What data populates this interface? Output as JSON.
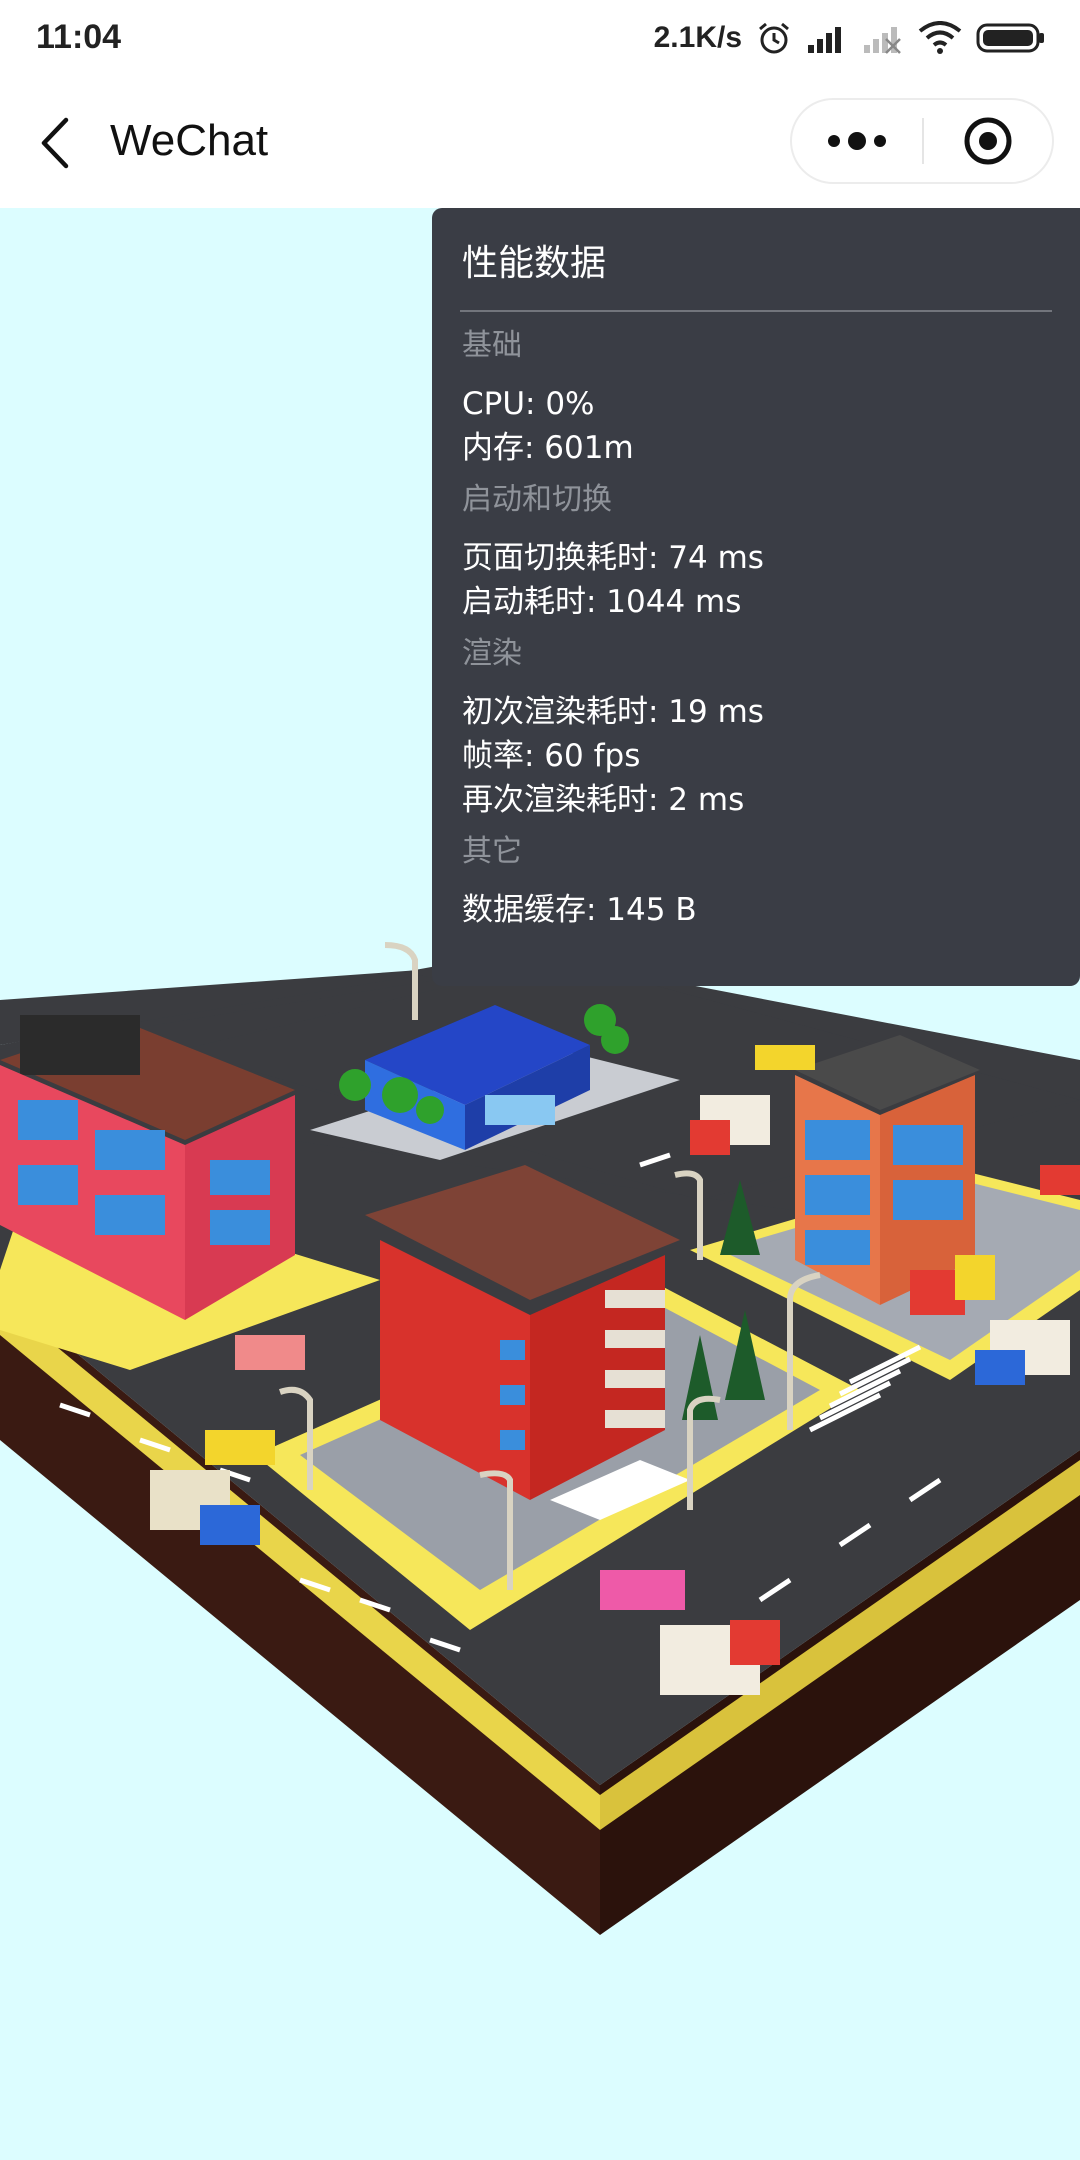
{
  "status_bar": {
    "time": "11:04",
    "net_speed": "2.1K/s",
    "icons": [
      "alarm-icon",
      "signal-icon",
      "signal-nosim-icon",
      "wifi-icon",
      "battery-icon"
    ]
  },
  "nav": {
    "title": "WeChat",
    "back_icon": "chevron-left-icon",
    "more_icon": "more-dots-icon",
    "close_icon": "target-circle-icon"
  },
  "perf_panel": {
    "title": "性能数据",
    "sections": [
      {
        "heading": "基础",
        "items": [
          "CPU: 0%",
          "内存: 601m"
        ]
      },
      {
        "heading": "启动和切换",
        "items": [
          "页面切换耗时: 74 ms",
          "启动耗时: 1044 ms"
        ]
      },
      {
        "heading": "渲染",
        "items": [
          "初次渲染耗时: 19 ms",
          "帧率: 60 fps",
          "再次渲染耗时: 2 ms"
        ]
      },
      {
        "heading": "其它",
        "items": [
          "数据缓存: 145 B"
        ]
      }
    ]
  },
  "colors": {
    "background": "#dcfdff",
    "panel": "#3a3d45",
    "road": "#3b3c40",
    "sidewalk": "#f6e75a",
    "red_building": "#d8322c",
    "pink_building": "#e8485e",
    "blue_roof": "#2446c7"
  }
}
